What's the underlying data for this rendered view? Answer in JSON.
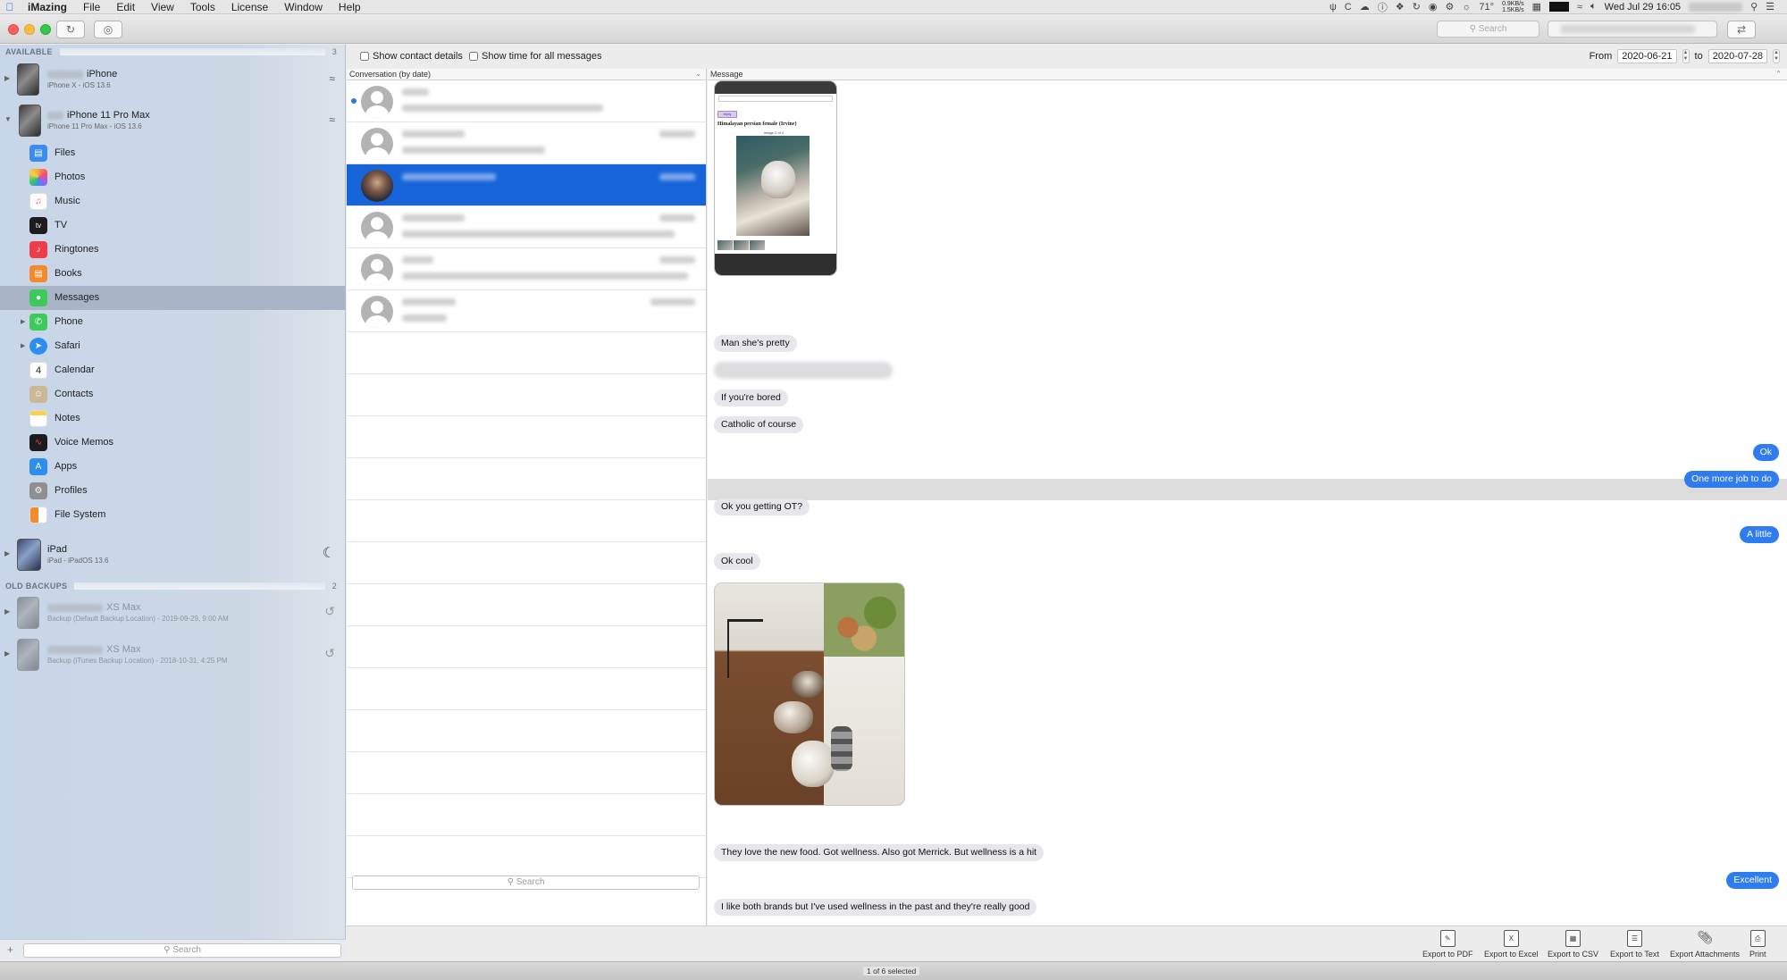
{
  "menubar": {
    "app_name": "iMazing",
    "items": [
      "File",
      "Edit",
      "View",
      "Tools",
      "License",
      "Window",
      "Help"
    ],
    "temperature": "71°",
    "net_up": "0.9KB/s",
    "net_down": "1.5KB/s",
    "clock": "Wed Jul 29  16:05"
  },
  "toolbar": {
    "search_placeholder": "Search"
  },
  "sidebar": {
    "available_label": "AVAILABLE",
    "available_count": "3",
    "devices": [
      {
        "name": "iPhone",
        "subtitle": "iPhone X - iOS 13.6"
      },
      {
        "name": "iPhone 11 Pro Max",
        "subtitle": "iPhone 11 Pro Max - iOS 13.6"
      },
      {
        "name": "iPad",
        "subtitle": "iPad - iPadOS 13.6"
      }
    ],
    "nav_items": [
      {
        "label": "Files",
        "icon": "folder-icon",
        "color": "#3b8cf0"
      },
      {
        "label": "Photos",
        "icon": "photos-icon",
        "color": "#f3a63a"
      },
      {
        "label": "Music",
        "icon": "music-icon",
        "color": "#fb4b6b"
      },
      {
        "label": "TV",
        "icon": "tv-icon",
        "color": "#1c1c1e"
      },
      {
        "label": "Ringtones",
        "icon": "ringtones-icon",
        "color": "#f03b4b"
      },
      {
        "label": "Books",
        "icon": "books-icon",
        "color": "#f5892b"
      },
      {
        "label": "Messages",
        "icon": "messages-icon",
        "color": "#3ccb5b"
      },
      {
        "label": "Phone",
        "icon": "phone-icon",
        "color": "#3ccb5b"
      },
      {
        "label": "Safari",
        "icon": "safari-icon",
        "color": "#2d8ef0"
      },
      {
        "label": "Calendar",
        "icon": "calendar-icon",
        "color": "#ffffff"
      },
      {
        "label": "Contacts",
        "icon": "contacts-icon",
        "color": "#c9b996"
      },
      {
        "label": "Notes",
        "icon": "notes-icon",
        "color": "#f7d24a"
      },
      {
        "label": "Voice Memos",
        "icon": "voice-memos-icon",
        "color": "#1c1c1e"
      },
      {
        "label": "Apps",
        "icon": "apps-icon",
        "color": "#2d8ef0"
      },
      {
        "label": "Profiles",
        "icon": "profiles-icon",
        "color": "#8e8e93"
      },
      {
        "label": "File System",
        "icon": "file-system-icon",
        "color": "#f5892b"
      }
    ],
    "calendar_day": "4",
    "old_backups_label": "OLD BACKUPS",
    "old_backups_count": "2",
    "backups": [
      {
        "name": "XS Max",
        "subtitle": "Backup (Default Backup Location) - 2019-09-29, 9:00 AM"
      },
      {
        "name": "XS Max",
        "subtitle": "Backup (iTunes Backup Location) - 2018-10-31, 4:25 PM"
      }
    ],
    "search_placeholder": "Search"
  },
  "options": {
    "show_contact_details": "Show contact details",
    "show_time": "Show time for all messages",
    "from_label": "From",
    "from_date": "2020-06-21",
    "to_label": "to",
    "to_date": "2020-07-28"
  },
  "conversations": {
    "header": "Conversation (by date)",
    "search_placeholder": "Search"
  },
  "messages": {
    "header": "Message",
    "screenshot_title": "Himalayan persian female (Irvine)",
    "screenshot_image_count": "image 2 of 4",
    "screenshot_reply": "reply",
    "bubbles": [
      {
        "text": "Man she's pretty",
        "dir": "in"
      },
      {
        "text": "If you're bored",
        "dir": "in"
      },
      {
        "text": "Catholic of course",
        "dir": "in"
      },
      {
        "text": "Ok",
        "dir": "out"
      },
      {
        "text": "One more job to do",
        "dir": "out"
      },
      {
        "text": "Ok you getting OT?",
        "dir": "in"
      },
      {
        "text": "A little",
        "dir": "out"
      },
      {
        "text": "Ok cool",
        "dir": "in"
      },
      {
        "text": "They love the new food. Got wellness. Also got Merrick. But wellness is a hit",
        "dir": "in"
      },
      {
        "text": "Excellent",
        "dir": "out"
      },
      {
        "text": "I like both brands but I've used wellness in the past and they're really good",
        "dir": "in"
      }
    ]
  },
  "export": {
    "pdf": "Export to PDF",
    "excel": "Export to Excel",
    "csv": "Export to CSV",
    "text": "Export to Text",
    "attachments": "Export Attachments",
    "print": "Print"
  },
  "status": {
    "selection": "1 of 6 selected"
  },
  "colors": {
    "selection_blue": "#1664d8",
    "outgoing_bubble": "#2e7cf0",
    "incoming_bubble": "#e6e6eb"
  }
}
